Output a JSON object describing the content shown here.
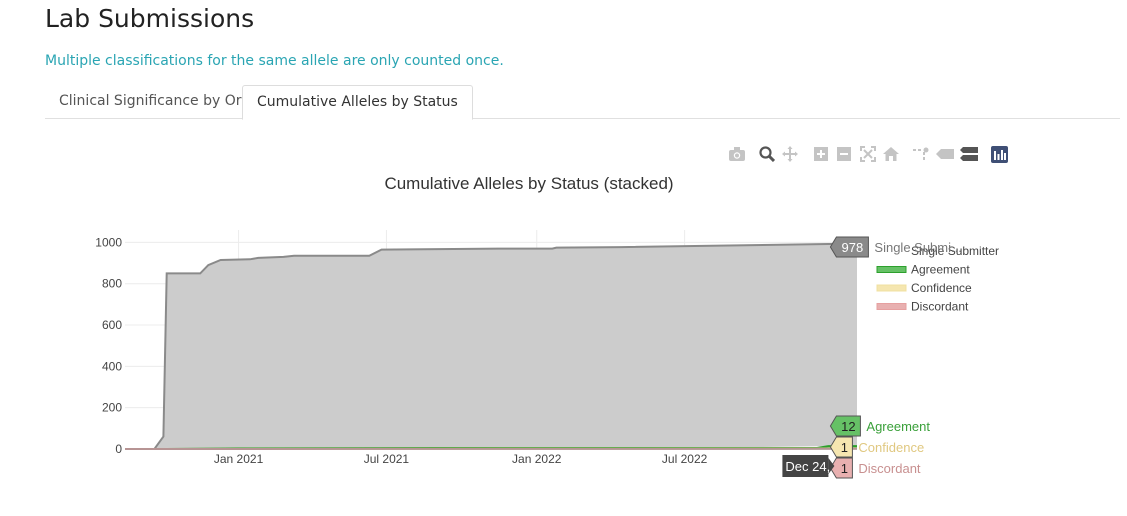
{
  "page": {
    "title": "Lab Submissions",
    "note": "Multiple classifications for the same allele are only counted once."
  },
  "tabs": [
    {
      "label": "Clinical Significance by Org",
      "active": false
    },
    {
      "label": "Cumulative Alleles by Status",
      "active": true
    }
  ],
  "toolbar": {
    "icons": [
      "camera-icon",
      "zoom-icon",
      "pan-icon",
      "zoom-in-icon",
      "zoom-out-icon",
      "autoscale-icon",
      "home-icon",
      "spike-lines-icon",
      "hover-closest-icon",
      "hover-compare-icon",
      "plotly-logo-icon"
    ]
  },
  "chart_data": {
    "type": "area",
    "title": "Cumulative Alleles by Status (stacked)",
    "xlabel": "",
    "ylabel": "",
    "x_ticks": [
      "Jan 2021",
      "Jul 2021",
      "Jan 2022",
      "Jul 2022"
    ],
    "y_ticks": [
      "0",
      "200",
      "400",
      "600",
      "800",
      "1000"
    ],
    "ylim": [
      0,
      1060
    ],
    "xlim": [
      "2020-08-15",
      "2023-01-28"
    ],
    "grid": true,
    "legend_position": "right",
    "hover_x_label": "Dec 24,",
    "series": [
      {
        "name": "Single Submitter",
        "hover_label": "Single Submi...",
        "hover_value": "978",
        "color": "#8a8a8a",
        "fill": "#cccccc",
        "points": [
          [
            "2020-08-15",
            0
          ],
          [
            "2020-09-20",
            0
          ],
          [
            "2020-10-01",
            60
          ],
          [
            "2020-10-05",
            850
          ],
          [
            "2020-11-15",
            850
          ],
          [
            "2020-11-25",
            890
          ],
          [
            "2020-12-10",
            915
          ],
          [
            "2021-01-15",
            918
          ],
          [
            "2021-01-25",
            925
          ],
          [
            "2021-02-25",
            930
          ],
          [
            "2021-03-10",
            935
          ],
          [
            "2021-06-10",
            935
          ],
          [
            "2021-06-25",
            965
          ],
          [
            "2021-08-15",
            967
          ],
          [
            "2021-11-15",
            970
          ],
          [
            "2022-01-20",
            970
          ],
          [
            "2022-01-25",
            975
          ],
          [
            "2022-04-15",
            977
          ],
          [
            "2022-12-24",
            978
          ],
          [
            "2023-01-28",
            978
          ]
        ]
      },
      {
        "name": "Agreement",
        "hover_label": "Agreement",
        "hover_value": "12",
        "color": "#2ca02c",
        "fill": "#66c166",
        "points": [
          [
            "2020-08-15",
            0
          ],
          [
            "2020-10-05",
            0
          ],
          [
            "2021-01-01",
            3
          ],
          [
            "2021-09-01",
            5
          ],
          [
            "2022-12-10",
            5
          ],
          [
            "2022-12-24",
            12
          ],
          [
            "2023-01-28",
            12
          ]
        ]
      },
      {
        "name": "Confidence",
        "hover_label": "Confidence",
        "hover_value": "1",
        "color": "#f0e0a0",
        "fill": "#f5e6b0",
        "points": [
          [
            "2020-08-15",
            0
          ],
          [
            "2022-12-24",
            1
          ],
          [
            "2023-01-28",
            1
          ]
        ]
      },
      {
        "name": "Discordant",
        "hover_label": "Discordant",
        "hover_value": "1",
        "color": "#e6a0a0",
        "fill": "#e8b0b0",
        "points": [
          [
            "2020-08-15",
            0
          ],
          [
            "2022-12-24",
            1
          ],
          [
            "2023-01-28",
            1
          ]
        ]
      }
    ]
  }
}
